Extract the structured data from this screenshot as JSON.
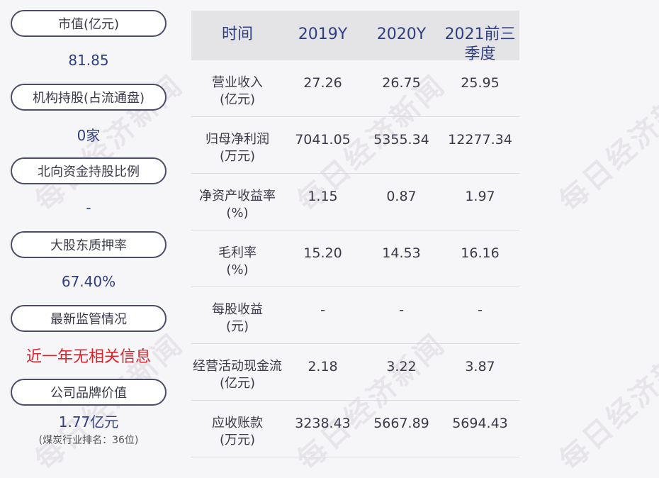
{
  "watermark": "每日经济新闻",
  "left": {
    "items": [
      {
        "label": "市值(亿元)",
        "value": "81.85"
      },
      {
        "label": "机构持股(占流通盘)",
        "value": "0家"
      },
      {
        "label": "北向资金持股比例",
        "value": "-"
      },
      {
        "label": "大股东质押率",
        "value": "67.40%"
      },
      {
        "label": "最新监管情况",
        "value": "近一年无相关信息"
      },
      {
        "label": "公司品牌价值",
        "value": "1.77亿元",
        "sub": "(煤炭行业排名：36位)"
      }
    ],
    "highlight_color": "#d7262d",
    "value_color": "#2f3f86"
  },
  "table": {
    "headers": [
      "时间",
      "2019Y",
      "2020Y",
      "2021前三季度"
    ],
    "rows": [
      {
        "label1": "营业收入",
        "label2": "(亿元)",
        "v": [
          "27.26",
          "26.75",
          "25.95"
        ]
      },
      {
        "label1": "归母净利润",
        "label2": "(万元)",
        "v": [
          "7041.05",
          "5355.34",
          "12277.34"
        ]
      },
      {
        "label1": "净资产收益率",
        "label2": "(%)",
        "v": [
          "1.15",
          "0.87",
          "1.97"
        ]
      },
      {
        "label1": "毛利率",
        "label2": "(%)",
        "v": [
          "15.20",
          "14.53",
          "16.16"
        ]
      },
      {
        "label1": "每股收益",
        "label2": "(元)",
        "v": [
          "-",
          "-",
          "-"
        ]
      },
      {
        "label1": "经营活动现金流",
        "label2": "(亿元)",
        "v": [
          "2.18",
          "3.22",
          "3.87"
        ]
      },
      {
        "label1": "应收账款",
        "label2": "(万元)",
        "v": [
          "3238.43",
          "5667.89",
          "5694.43"
        ]
      }
    ]
  }
}
